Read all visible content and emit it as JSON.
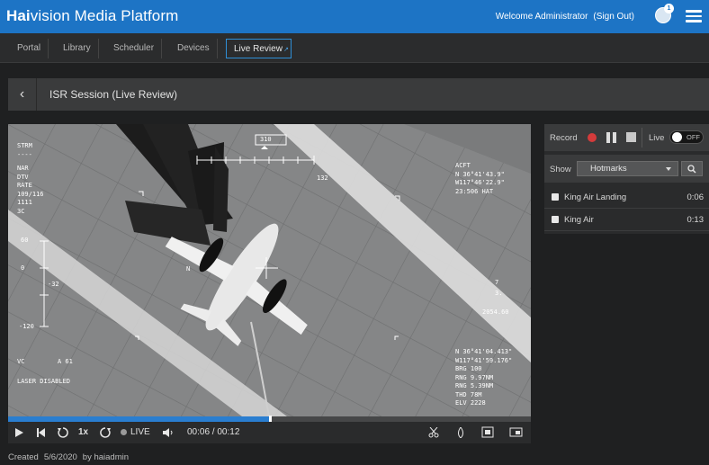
{
  "header": {
    "brand_bold": "Hai",
    "brand_rest": "vision Media Platform",
    "welcome": "Welcome Administrator",
    "signout": "(Sign Out)",
    "notification_count": "1",
    "menu_icon": "hamburger-icon"
  },
  "nav": {
    "tabs": [
      "Portal",
      "Library",
      "Scheduler",
      "Devices",
      "Live Review"
    ],
    "active_tab": "Live Review"
  },
  "session": {
    "title": "ISR Session (Live Review)",
    "back_icon": "chevron-left-icon"
  },
  "video": {
    "hud": {
      "top_left": [
        "STRM",
        "----",
        "NAR",
        "DTV",
        "RATE",
        "109/116",
        "1111",
        "3C"
      ],
      "scale_left": [
        "60",
        "0",
        "-32",
        "-120"
      ],
      "heading": "310",
      "heading_sub": "132",
      "top_right": [
        "ACFT",
        "N 36°41'43.9\"",
        "W117°46'22.9\"",
        "23:506 HAT"
      ],
      "right_mid": [
        "7",
        "3.",
        "2054.60"
      ],
      "bottom_left": [
        "VC",
        "A 61",
        "LASER DISABLED"
      ],
      "bottom_right": [
        "N 36°41'04.413\"",
        "W117°41'59.176\"",
        "BRG    100",
        "RNG   9.97NM",
        "RNG   5.39NM",
        "THD     78M",
        "ELV    2228"
      ],
      "north": "N"
    },
    "progress_fraction": 0.5
  },
  "controls": {
    "speed": "1x",
    "live_label": "LIVE",
    "time_current": "00:06",
    "time_total": "00:12",
    "time_sep": " / "
  },
  "meta": {
    "created_label": "Created",
    "created_date": "5/6/2020",
    "created_by": "by haiadmin"
  },
  "record": {
    "record_label": "Record",
    "live_label": "Live",
    "toggle_state": "OFF"
  },
  "show": {
    "label": "Show",
    "selected": "Hotmarks"
  },
  "hotmarks": [
    {
      "name": "King Air Landing",
      "time": "0:06"
    },
    {
      "name": "King Air",
      "time": "0:13"
    }
  ],
  "colors": {
    "header_blue": "#1d74c5",
    "accent_blue": "#2a7ed0",
    "record_red": "#d43b3b",
    "panel_dark": "#2a2b2c"
  }
}
